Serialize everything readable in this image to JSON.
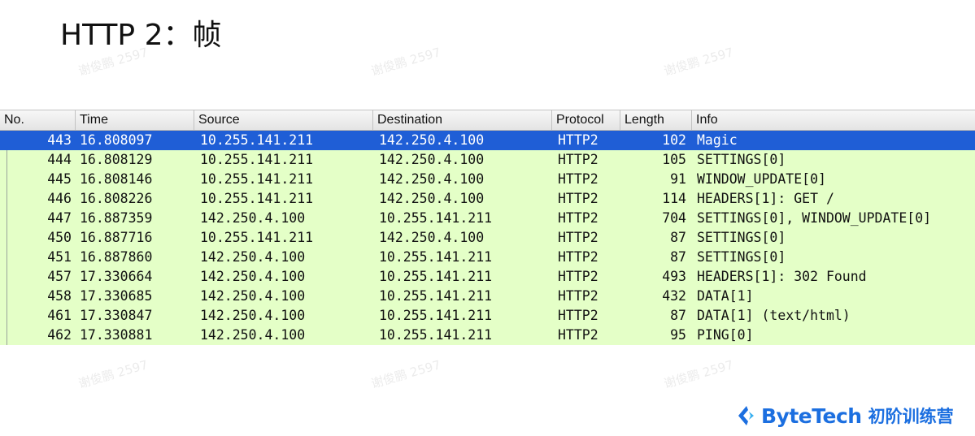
{
  "slide": {
    "title": "HTTP 2：帧"
  },
  "watermark_text": "谢俊鹏 2597",
  "packet_list": {
    "columns": [
      "No.",
      "Time",
      "Source",
      "Destination",
      "Protocol",
      "Length",
      "Info"
    ],
    "selected_index": 0,
    "colors": {
      "row_bg": "#e4ffc7",
      "selected_bg": "#1f5ed6",
      "selected_text": "#ffffff"
    },
    "rows": [
      {
        "no": "443",
        "time": "16.808097",
        "source": "10.255.141.211",
        "destination": "142.250.4.100",
        "protocol": "HTTP2",
        "length": "102",
        "info": "Magic"
      },
      {
        "no": "444",
        "time": "16.808129",
        "source": "10.255.141.211",
        "destination": "142.250.4.100",
        "protocol": "HTTP2",
        "length": "105",
        "info": "SETTINGS[0]"
      },
      {
        "no": "445",
        "time": "16.808146",
        "source": "10.255.141.211",
        "destination": "142.250.4.100",
        "protocol": "HTTP2",
        "length": "91",
        "info": "WINDOW_UPDATE[0]"
      },
      {
        "no": "446",
        "time": "16.808226",
        "source": "10.255.141.211",
        "destination": "142.250.4.100",
        "protocol": "HTTP2",
        "length": "114",
        "info": "HEADERS[1]: GET /"
      },
      {
        "no": "447",
        "time": "16.887359",
        "source": "142.250.4.100",
        "destination": "10.255.141.211",
        "protocol": "HTTP2",
        "length": "704",
        "info": "SETTINGS[0], WINDOW_UPDATE[0]"
      },
      {
        "no": "450",
        "time": "16.887716",
        "source": "10.255.141.211",
        "destination": "142.250.4.100",
        "protocol": "HTTP2",
        "length": "87",
        "info": "SETTINGS[0]"
      },
      {
        "no": "451",
        "time": "16.887860",
        "source": "142.250.4.100",
        "destination": "10.255.141.211",
        "protocol": "HTTP2",
        "length": "87",
        "info": "SETTINGS[0]"
      },
      {
        "no": "457",
        "time": "17.330664",
        "source": "142.250.4.100",
        "destination": "10.255.141.211",
        "protocol": "HTTP2",
        "length": "493",
        "info": "HEADERS[1]: 302 Found"
      },
      {
        "no": "458",
        "time": "17.330685",
        "source": "142.250.4.100",
        "destination": "10.255.141.211",
        "protocol": "HTTP2",
        "length": "432",
        "info": "DATA[1]"
      },
      {
        "no": "461",
        "time": "17.330847",
        "source": "142.250.4.100",
        "destination": "10.255.141.211",
        "protocol": "HTTP2",
        "length": "87",
        "info": "DATA[1] (text/html)"
      },
      {
        "no": "462",
        "time": "17.330881",
        "source": "142.250.4.100",
        "destination": "10.255.141.211",
        "protocol": "HTTP2",
        "length": "95",
        "info": "PING[0]"
      }
    ]
  },
  "brand": {
    "name": "ByteTech",
    "tag": "初阶训练营",
    "color": "#1c6fe0"
  }
}
